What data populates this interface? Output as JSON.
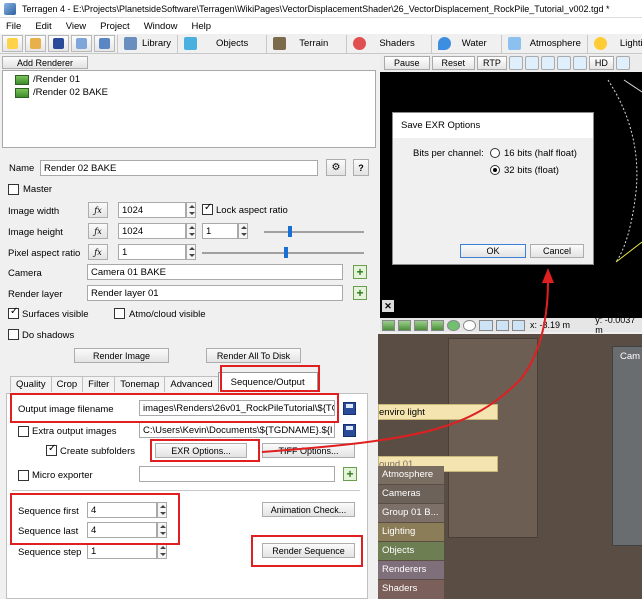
{
  "window": {
    "title": "Terragen 4 - E:\\Projects\\PlanetsideSoftware\\Terragen\\WikiPages\\VectorDisplacementShader\\26_VectorDisplacement_RockPile_Tutorial_v002.tgd *"
  },
  "menu": [
    "File",
    "Edit",
    "View",
    "Project",
    "Window",
    "Help"
  ],
  "toolbar": {
    "tabs": [
      {
        "label": "Library",
        "icon": "library-icon"
      },
      {
        "label": "Objects",
        "icon": "cube-icon"
      },
      {
        "label": "Terrain",
        "icon": "terrain-icon"
      },
      {
        "label": "Shaders",
        "icon": "shader-ball-icon"
      },
      {
        "label": "Water",
        "icon": "water-drop-icon"
      },
      {
        "label": "Atmosphere",
        "icon": "sky-icon"
      },
      {
        "label": "Lighting",
        "icon": "sun-icon"
      }
    ]
  },
  "renderers": {
    "add_button": "Add Renderer",
    "items": [
      "/Render 01",
      "/Render 02 BAKE"
    ]
  },
  "form": {
    "name_label": "Name",
    "name_value": "Render 02 BAKE",
    "master_label": "Master",
    "image_width_label": "Image width",
    "image_width_value": "1024",
    "lock_aspect_label": "Lock aspect ratio",
    "image_height_label": "Image height",
    "image_height_value": "1024",
    "image_height_mult": "1",
    "pixel_aspect_label": "Pixel aspect ratio",
    "pixel_aspect_value": "1",
    "camera_label": "Camera",
    "camera_value": "Camera 01 BAKE",
    "render_layer_label": "Render layer",
    "render_layer_value": "Render layer 01",
    "surfaces_visible_label": "Surfaces visible",
    "atmo_visible_label": "Atmo/cloud visible",
    "do_shadows_label": "Do shadows",
    "render_image_button": "Render Image",
    "render_all_button": "Render All To Disk"
  },
  "tabs": [
    "Quality",
    "Crop",
    "Filter",
    "Tonemap",
    "Advanced",
    "Sequence/Output"
  ],
  "sequence_output": {
    "output_filename_label": "Output image filename",
    "output_filename_value": "images\\Renders\\26v01_RockPileTutorial\\${TG",
    "extra_output_label": "Extra output images",
    "extra_output_value": "C:\\Users\\Kevin\\Documents\\${TGDNAME}.${I",
    "create_subfolders_label": "Create subfolders",
    "exr_options_button": "EXR Options...",
    "tiff_options_button": "TIFF Options...",
    "micro_exporter_label": "Micro exporter",
    "sequence_first_label": "Sequence first",
    "sequence_first_value": "4",
    "sequence_last_label": "Sequence last",
    "sequence_last_value": "4",
    "sequence_step_label": "Sequence step",
    "sequence_step_value": "1",
    "animation_check_button": "Animation Check...",
    "render_sequence_button": "Render Sequence"
  },
  "viewport": {
    "pause": "Pause",
    "reset": "Reset",
    "rtp": "RTP",
    "hd": "HD",
    "coord_x": "x: -3.19 m",
    "coord_y": "y: -0.0037 m"
  },
  "nodes": {
    "enviro_light": "enviro light",
    "node_list": [
      "Atmosphere",
      "Cameras",
      "Group 01 B...",
      "Lighting",
      "Objects",
      "Renderers",
      "Shaders"
    ],
    "partial_label": "Cam",
    "partial_tag": "ound 01"
  },
  "dialog": {
    "title": "Save EXR Options",
    "bits_label": "Bits per channel:",
    "option_16": "16 bits (half float)",
    "option_32": "32 bits (float)",
    "ok": "OK",
    "cancel": "Cancel"
  },
  "colors": {
    "highlight": "#e02020",
    "node_bg": "#5a4e44",
    "node_item_bg": "#7a6d62"
  }
}
